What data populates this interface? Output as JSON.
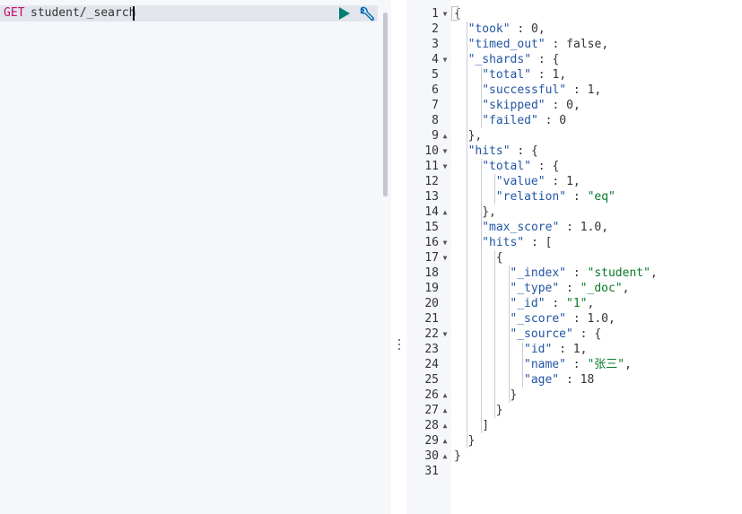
{
  "request": {
    "method": "GET",
    "path": "student/_search"
  },
  "icons": {
    "run": "play-icon",
    "settings": "wrench-icon",
    "fold_open": "fold-down-triangle",
    "fold_close": "fold-up-triangle"
  },
  "colors": {
    "method": "#c80a68",
    "key": "#2255a4",
    "string": "#087a27",
    "run_button": "#017d73",
    "settings_button": "#006bb4"
  },
  "response": {
    "lines": [
      {
        "n": "1",
        "fold": "open",
        "indent": 0,
        "tokens": [
          [
            "punct",
            "{"
          ]
        ]
      },
      {
        "n": "2",
        "fold": "",
        "indent": 1,
        "tokens": [
          [
            "key",
            "\"took\""
          ],
          [
            "punct",
            " : "
          ],
          [
            "num",
            "0"
          ],
          [
            "punct",
            ","
          ]
        ]
      },
      {
        "n": "3",
        "fold": "",
        "indent": 1,
        "tokens": [
          [
            "key",
            "\"timed_out\""
          ],
          [
            "punct",
            " : "
          ],
          [
            "bool",
            "false"
          ],
          [
            "punct",
            ","
          ]
        ]
      },
      {
        "n": "4",
        "fold": "open",
        "indent": 1,
        "tokens": [
          [
            "key",
            "\"_shards\""
          ],
          [
            "punct",
            " : {"
          ]
        ]
      },
      {
        "n": "5",
        "fold": "",
        "indent": 2,
        "tokens": [
          [
            "key",
            "\"total\""
          ],
          [
            "punct",
            " : "
          ],
          [
            "num",
            "1"
          ],
          [
            "punct",
            ","
          ]
        ]
      },
      {
        "n": "6",
        "fold": "",
        "indent": 2,
        "tokens": [
          [
            "key",
            "\"successful\""
          ],
          [
            "punct",
            " : "
          ],
          [
            "num",
            "1"
          ],
          [
            "punct",
            ","
          ]
        ]
      },
      {
        "n": "7",
        "fold": "",
        "indent": 2,
        "tokens": [
          [
            "key",
            "\"skipped\""
          ],
          [
            "punct",
            " : "
          ],
          [
            "num",
            "0"
          ],
          [
            "punct",
            ","
          ]
        ]
      },
      {
        "n": "8",
        "fold": "",
        "indent": 2,
        "tokens": [
          [
            "key",
            "\"failed\""
          ],
          [
            "punct",
            " : "
          ],
          [
            "num",
            "0"
          ]
        ]
      },
      {
        "n": "9",
        "fold": "close",
        "indent": 1,
        "tokens": [
          [
            "punct",
            "},"
          ]
        ]
      },
      {
        "n": "10",
        "fold": "open",
        "indent": 1,
        "tokens": [
          [
            "key",
            "\"hits\""
          ],
          [
            "punct",
            " : {"
          ]
        ]
      },
      {
        "n": "11",
        "fold": "open",
        "indent": 2,
        "tokens": [
          [
            "key",
            "\"total\""
          ],
          [
            "punct",
            " : {"
          ]
        ]
      },
      {
        "n": "12",
        "fold": "",
        "indent": 3,
        "tokens": [
          [
            "key",
            "\"value\""
          ],
          [
            "punct",
            " : "
          ],
          [
            "num",
            "1"
          ],
          [
            "punct",
            ","
          ]
        ]
      },
      {
        "n": "13",
        "fold": "",
        "indent": 3,
        "tokens": [
          [
            "key",
            "\"relation\""
          ],
          [
            "punct",
            " : "
          ],
          [
            "str",
            "\"eq\""
          ]
        ]
      },
      {
        "n": "14",
        "fold": "close",
        "indent": 2,
        "tokens": [
          [
            "punct",
            "},"
          ]
        ]
      },
      {
        "n": "15",
        "fold": "",
        "indent": 2,
        "tokens": [
          [
            "key",
            "\"max_score\""
          ],
          [
            "punct",
            " : "
          ],
          [
            "num",
            "1.0"
          ],
          [
            "punct",
            ","
          ]
        ]
      },
      {
        "n": "16",
        "fold": "open",
        "indent": 2,
        "tokens": [
          [
            "key",
            "\"hits\""
          ],
          [
            "punct",
            " : ["
          ]
        ]
      },
      {
        "n": "17",
        "fold": "open",
        "indent": 3,
        "tokens": [
          [
            "punct",
            "{"
          ]
        ]
      },
      {
        "n": "18",
        "fold": "",
        "indent": 4,
        "tokens": [
          [
            "key",
            "\"_index\""
          ],
          [
            "punct",
            " : "
          ],
          [
            "str",
            "\"student\""
          ],
          [
            "punct",
            ","
          ]
        ]
      },
      {
        "n": "19",
        "fold": "",
        "indent": 4,
        "tokens": [
          [
            "key",
            "\"_type\""
          ],
          [
            "punct",
            " : "
          ],
          [
            "str",
            "\"_doc\""
          ],
          [
            "punct",
            ","
          ]
        ]
      },
      {
        "n": "20",
        "fold": "",
        "indent": 4,
        "tokens": [
          [
            "key",
            "\"_id\""
          ],
          [
            "punct",
            " : "
          ],
          [
            "str",
            "\"1\""
          ],
          [
            "punct",
            ","
          ]
        ]
      },
      {
        "n": "21",
        "fold": "",
        "indent": 4,
        "tokens": [
          [
            "key",
            "\"_score\""
          ],
          [
            "punct",
            " : "
          ],
          [
            "num",
            "1.0"
          ],
          [
            "punct",
            ","
          ]
        ]
      },
      {
        "n": "22",
        "fold": "open",
        "indent": 4,
        "tokens": [
          [
            "key",
            "\"_source\""
          ],
          [
            "punct",
            " : {"
          ]
        ]
      },
      {
        "n": "23",
        "fold": "",
        "indent": 5,
        "tokens": [
          [
            "key",
            "\"id\""
          ],
          [
            "punct",
            " : "
          ],
          [
            "num",
            "1"
          ],
          [
            "punct",
            ","
          ]
        ]
      },
      {
        "n": "24",
        "fold": "",
        "indent": 5,
        "tokens": [
          [
            "key",
            "\"name\""
          ],
          [
            "punct",
            " : "
          ],
          [
            "str",
            "\"张三\""
          ],
          [
            "punct",
            ","
          ]
        ]
      },
      {
        "n": "25",
        "fold": "",
        "indent": 5,
        "tokens": [
          [
            "key",
            "\"age\""
          ],
          [
            "punct",
            " : "
          ],
          [
            "num",
            "18"
          ]
        ]
      },
      {
        "n": "26",
        "fold": "close",
        "indent": 4,
        "tokens": [
          [
            "punct",
            "}"
          ]
        ]
      },
      {
        "n": "27",
        "fold": "close",
        "indent": 3,
        "tokens": [
          [
            "punct",
            "}"
          ]
        ]
      },
      {
        "n": "28",
        "fold": "close",
        "indent": 2,
        "tokens": [
          [
            "punct",
            "]"
          ]
        ]
      },
      {
        "n": "29",
        "fold": "close",
        "indent": 1,
        "tokens": [
          [
            "punct",
            "}"
          ]
        ]
      },
      {
        "n": "30",
        "fold": "close",
        "indent": 0,
        "tokens": [
          [
            "punct",
            "}"
          ]
        ]
      },
      {
        "n": "31",
        "fold": "",
        "indent": 0,
        "tokens": []
      }
    ]
  }
}
